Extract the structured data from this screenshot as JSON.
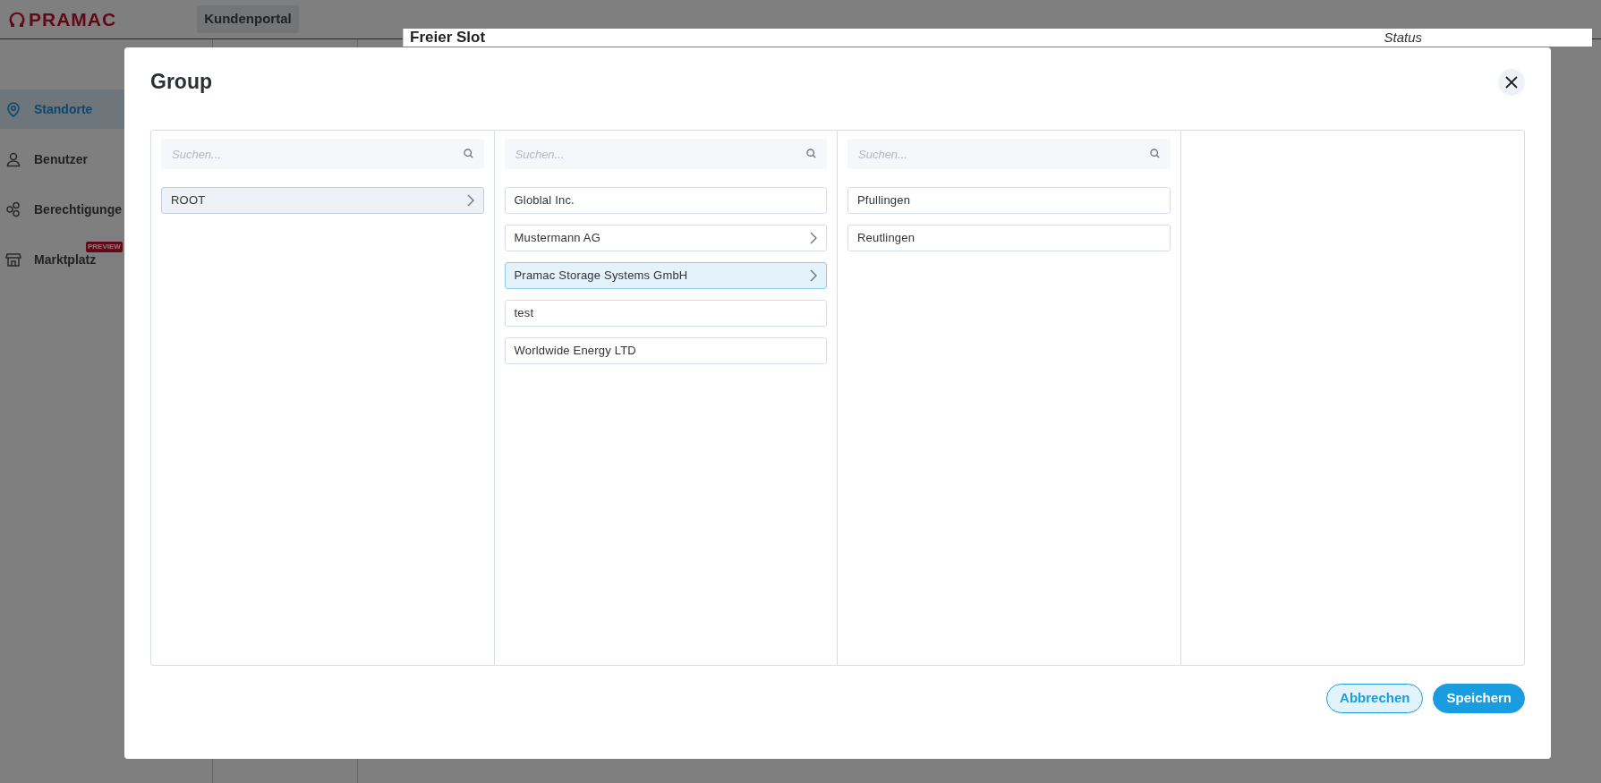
{
  "header": {
    "logo": "PRAMAC",
    "tabs": [
      {
        "label": "Kundenportal",
        "selected": true
      }
    ]
  },
  "sidebar": {
    "items": [
      {
        "label": "Standorte",
        "selected": true
      },
      {
        "label": "Benutzer",
        "selected": false
      },
      {
        "label": "Berechtigunge",
        "selected": false
      },
      {
        "label": "Marktplatz",
        "selected": false,
        "badge": "PREVIEW"
      }
    ]
  },
  "background_card": {
    "title": "Freier Slot",
    "status_label": "Status"
  },
  "dialog": {
    "title": "Group",
    "columns": [
      {
        "search": {
          "placeholder": "Suchen..."
        },
        "items": [
          {
            "label": "ROOT",
            "has_children": true,
            "selected": true
          }
        ]
      },
      {
        "search": {
          "placeholder": "Suchen..."
        },
        "items": [
          {
            "label": "Globlal Inc.",
            "has_children": false,
            "selected": false
          },
          {
            "label": "Mustermann AG",
            "has_children": true,
            "selected": false
          },
          {
            "label": "Pramac Storage Systems GmbH",
            "has_children": true,
            "selected": true
          },
          {
            "label": "test",
            "has_children": false,
            "selected": false
          },
          {
            "label": "Worldwide Energy LTD",
            "has_children": false,
            "selected": false
          }
        ]
      },
      {
        "search": {
          "placeholder": "Suchen..."
        },
        "items": [
          {
            "label": "Pfullingen",
            "has_children": false,
            "selected": false
          },
          {
            "label": "Reutlingen",
            "has_children": false,
            "selected": false
          }
        ]
      }
    ],
    "buttons": [
      {
        "label": "Abbrechen",
        "kind": "secondary"
      },
      {
        "label": "Speichern",
        "kind": "primary"
      }
    ]
  }
}
